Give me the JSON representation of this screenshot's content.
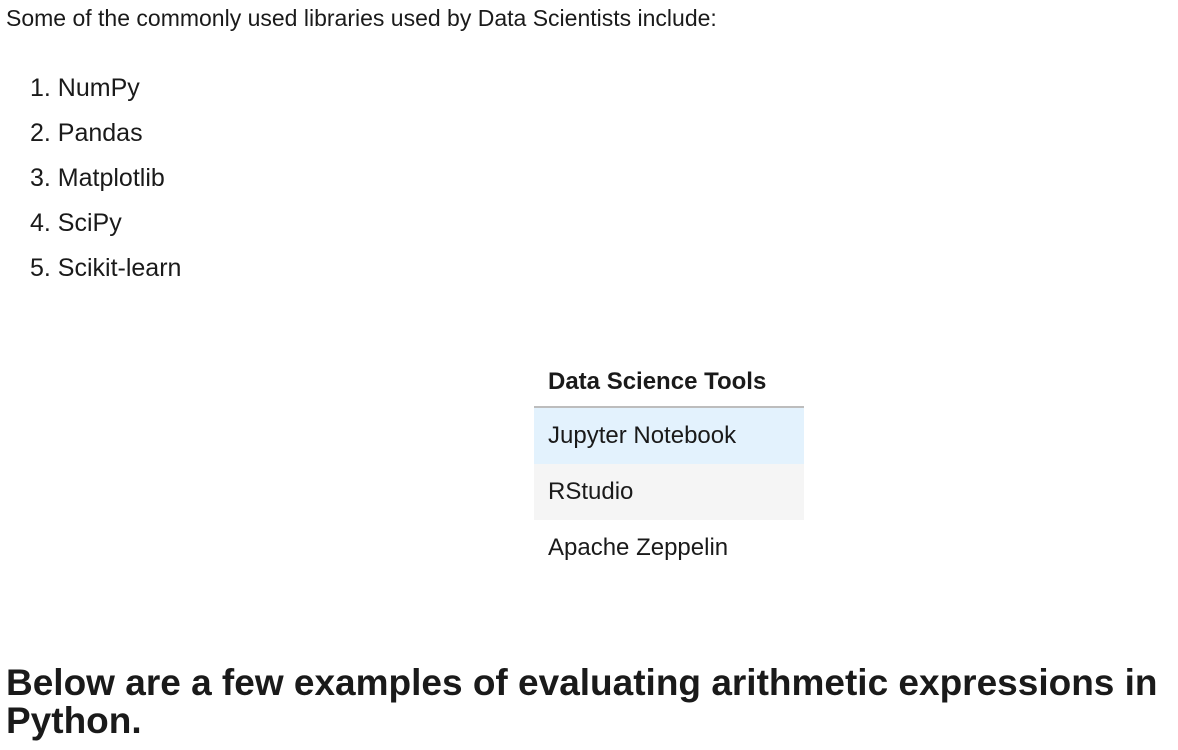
{
  "intro": "Some of the commonly used libraries used by Data Scientists include:",
  "libraries": [
    "1. NumPy",
    "2. Pandas",
    "3. Matplotlib",
    "4. SciPy",
    "5. Scikit-learn"
  ],
  "table": {
    "header": "Data Science Tools",
    "rows": [
      "Jupyter Notebook",
      "RStudio",
      "Apache Zeppelin"
    ]
  },
  "heading": "Below are a few examples of evaluating arithmetic expressions in Python."
}
